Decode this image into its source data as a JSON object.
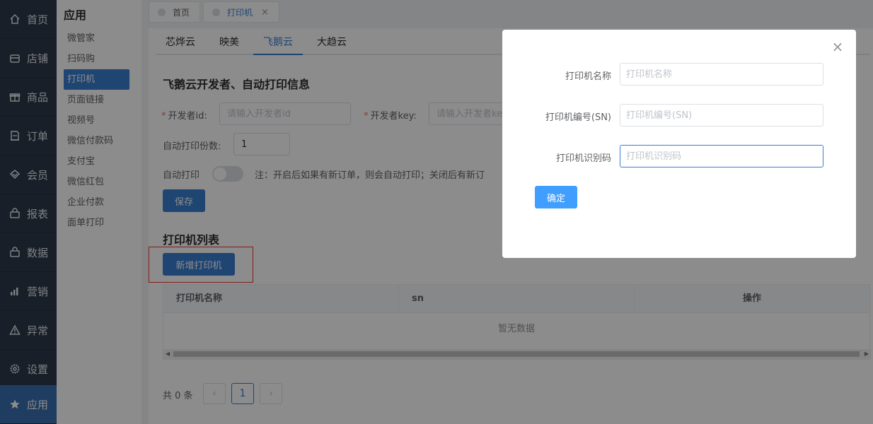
{
  "nav": {
    "items": [
      {
        "label": "首页",
        "icon": "home-icon"
      },
      {
        "label": "店铺",
        "icon": "store-icon"
      },
      {
        "label": "商品",
        "icon": "gift-icon"
      },
      {
        "label": "订单",
        "icon": "order-icon"
      },
      {
        "label": "会员",
        "icon": "diamond-icon"
      },
      {
        "label": "报表",
        "icon": "basket-icon"
      },
      {
        "label": "数据",
        "icon": "basket-icon"
      },
      {
        "label": "营销",
        "icon": "bar-chart-icon"
      },
      {
        "label": "异常",
        "icon": "warning-icon"
      },
      {
        "label": "设置",
        "icon": "gear-icon"
      },
      {
        "label": "应用",
        "icon": "star-icon"
      }
    ]
  },
  "subnav": {
    "title": "应用",
    "items": [
      "微管家",
      "扫码购",
      "打印机",
      "页面链接",
      "视频号",
      "微信付款码",
      "支付宝",
      "微信红包",
      "企业付款",
      "面单打印"
    ],
    "active": "打印机"
  },
  "pagetabs": [
    {
      "label": "首页"
    },
    {
      "label": "打印机",
      "close": "×"
    }
  ],
  "tabs": [
    "芯烨云",
    "映美",
    "飞鹅云",
    "大趋云"
  ],
  "form": {
    "section_title": "飞鹅云开发者、自动打印信息",
    "dev_id_label": "开发者id:",
    "dev_id_placeholder": "请输入开发者id",
    "dev_key_label": "开发者key:",
    "dev_key_placeholder": "请输入开发者key",
    "copies_label": "自动打印份数:",
    "copies_value": "1",
    "auto_print_label": "自动打印",
    "auto_print_note": "注：开启后如果有新订单，则会自动打印；关闭后有新订",
    "required_mark": "*",
    "save_label": "保存"
  },
  "printers": {
    "title": "打印机列表",
    "add_label": "新增打印机",
    "columns": [
      "打印机名称",
      "sn",
      "操作"
    ],
    "empty_text": "暂无数据",
    "total_text": "共 0 条",
    "current_page": "1",
    "prev": "‹",
    "next": "›"
  },
  "modal": {
    "close": "×",
    "name_label": "打印机名称",
    "name_placeholder": "打印机名称",
    "sn_label": "打印机编号(SN)",
    "sn_placeholder": "打印机编号(SN)",
    "key_label": "打印机识别码",
    "key_placeholder": "打印机识别码",
    "confirm_label": "确定"
  },
  "colors": {
    "primary": "#3a7ed1",
    "nav_bg": "#2d3a4b",
    "confirm": "#409eff"
  }
}
